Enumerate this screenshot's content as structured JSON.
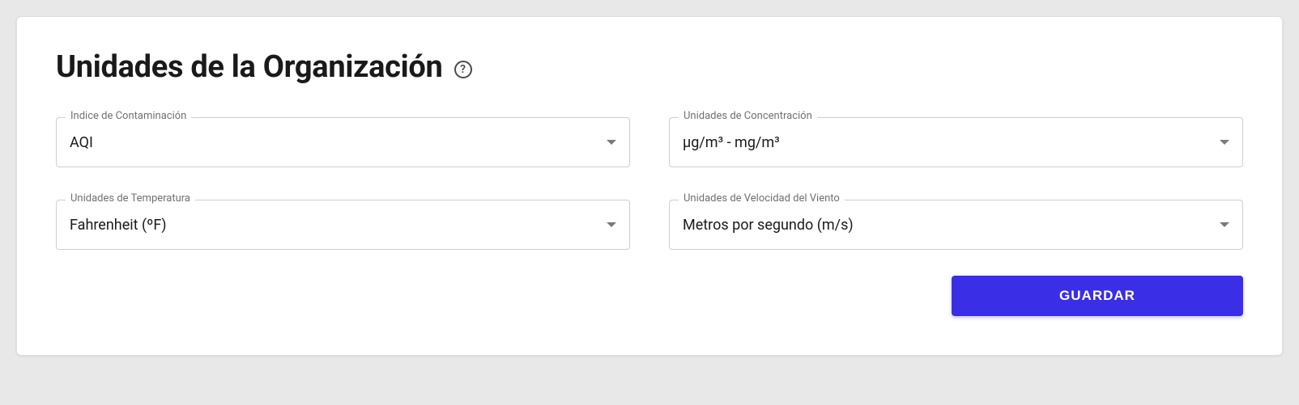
{
  "header": {
    "title": "Unidades de la Organización",
    "help_symbol": "?"
  },
  "fields": {
    "pollution_index": {
      "label": "Indice de Contaminación",
      "value": "AQI"
    },
    "concentration": {
      "label": "Unidades de Concentración",
      "value": "µg/m³ - mg/m³"
    },
    "temperature": {
      "label": "Unidades de Temperatura",
      "value": "Fahrenheit (ºF)"
    },
    "wind_speed": {
      "label": "Unidades de Velocidad del Viento",
      "value": "Metros por segundo (m/s)"
    }
  },
  "actions": {
    "save_label": "GUARDAR"
  }
}
